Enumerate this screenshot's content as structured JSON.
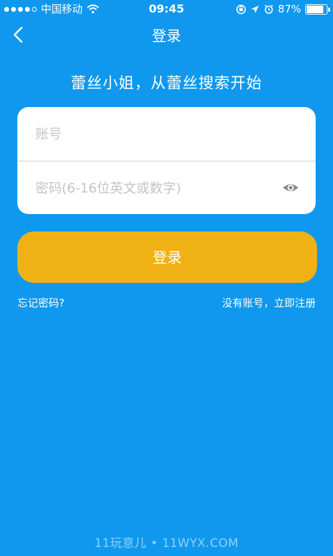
{
  "status_bar": {
    "carrier": "中国移动",
    "time": "09:45",
    "battery_percent": "87%",
    "battery_level": 0.87
  },
  "nav": {
    "title": "登录"
  },
  "slogan": "蕾丝小姐，从蕾丝搜索开始",
  "form": {
    "account_placeholder": "账号",
    "password_placeholder": "密码(6-16位英文或数字)"
  },
  "login_button_label": "登录",
  "links": {
    "forgot": "忘记密码?",
    "register": "没有账号，立即注册"
  },
  "watermark": "11玩意儿 • 11WYX.COM",
  "colors": {
    "background": "#0f98ee",
    "accent": "#f0b114",
    "card": "#ffffff"
  }
}
